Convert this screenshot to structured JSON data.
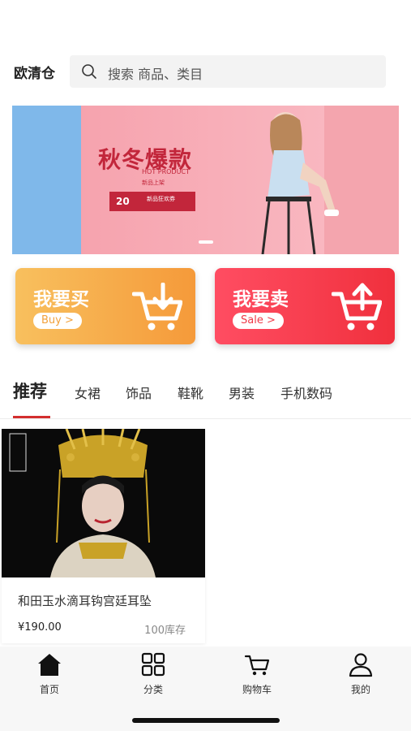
{
  "header": {
    "brand": "欧清仓",
    "search_placeholder": "搜索 商品、类目"
  },
  "banner": {
    "title": "秋冬爆款",
    "subtitle": "HOT PRODUCT",
    "tagline": "新品上架",
    "coupon_amount": "20",
    "coupon_label": "新品狂欢券"
  },
  "actions": {
    "buy_title": "我要买",
    "buy_pill": "Buy >",
    "sell_title": "我要卖",
    "sell_pill": "Sale >"
  },
  "tabs": [
    "推荐",
    "女裙",
    "饰品",
    "鞋靴",
    "男装",
    "手机数码"
  ],
  "product": {
    "name": "和田玉水滴耳钩宫廷耳坠",
    "price": "¥190.00",
    "stock": "100库存"
  },
  "nav": {
    "home": "首页",
    "category": "分类",
    "cart": "购物车",
    "mine": "我的"
  },
  "colors": {
    "accent_red": "#d32e2e",
    "buy_orange": "#f59a3a",
    "sell_red": "#f0303d"
  }
}
